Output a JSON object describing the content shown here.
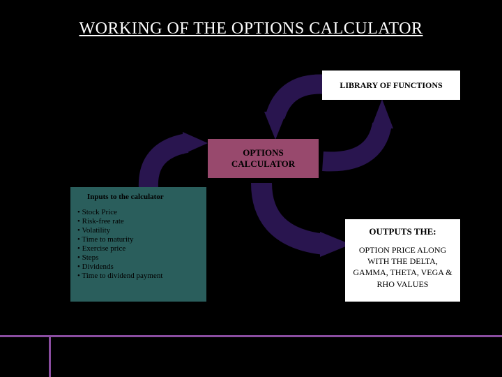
{
  "title": "WORKING OF THE OPTIONS CALCULATOR",
  "library": {
    "label": "LIBRARY OF FUNCTIONS"
  },
  "calculator": {
    "label": "OPTIONS CALCULATOR"
  },
  "inputs": {
    "title": "Inputs to the calculator",
    "items": [
      "Stock Price",
      "Risk-free rate",
      "Volatility",
      "Time to maturity",
      "Exercise price",
      "Steps",
      "Dividends",
      "Time to dividend payment"
    ]
  },
  "outputs": {
    "title": "OUTPUTS THE:",
    "body": "OPTION PRICE ALONG WITH THE DELTA, GAMMA, THETA, VEGA & RHO VALUES"
  },
  "colors": {
    "background": "#000000",
    "title_text": "#ffffff",
    "accent_line": "#8a4da0",
    "arrow": "#29154f",
    "inputs_box": "#2a5e5c",
    "calculator_box": "#98496d"
  }
}
